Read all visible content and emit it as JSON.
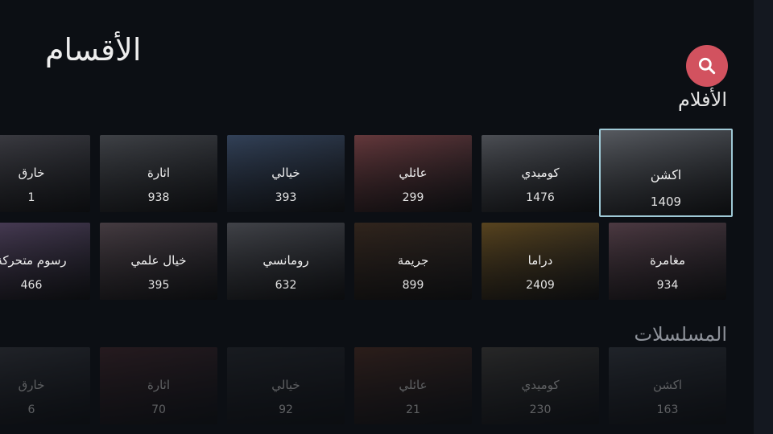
{
  "page_title": "الأقسام",
  "colors": {
    "accent": "#d2525f",
    "focus_border": "#9fc9d6",
    "background": "#0c0f14"
  },
  "search": {
    "icon": "search-icon"
  },
  "movies": {
    "title": "الأفلام",
    "rows": [
      [
        {
          "name": "اكشن",
          "count": "1409",
          "focused": true,
          "bg": "#6a6e75"
        },
        {
          "name": "كوميدي",
          "count": "1476",
          "bg": "#5c5f66"
        },
        {
          "name": "عائلي",
          "count": "299",
          "bg": "#7a4448"
        },
        {
          "name": "خيالي",
          "count": "393",
          "bg": "#3d4f6b"
        },
        {
          "name": "اثارة",
          "count": "938",
          "bg": "#4c4f55"
        },
        {
          "name": "خارق",
          "count": "1",
          "bg": "#4a4a52"
        }
      ],
      [
        {
          "name": "مغامرة",
          "count": "934",
          "bg": "#5d4650"
        },
        {
          "name": "دراما",
          "count": "2409",
          "bg": "#6b5225"
        },
        {
          "name": "جريمة",
          "count": "899",
          "bg": "#3b2c22"
        },
        {
          "name": "رومانسي",
          "count": "632",
          "bg": "#4f5158"
        },
        {
          "name": "خيال علمي",
          "count": "395",
          "bg": "#54484f"
        },
        {
          "name": "رسوم متحركة",
          "count": "466",
          "bg": "#5a4a6a"
        }
      ]
    ]
  },
  "series": {
    "title": "المسلسلات",
    "rows": [
      [
        {
          "name": "اكشن",
          "count": "163",
          "bg": "#4a4f58"
        },
        {
          "name": "كوميدي",
          "count": "230",
          "bg": "#5f5a52"
        },
        {
          "name": "عائلي",
          "count": "21",
          "bg": "#6b3d2c"
        },
        {
          "name": "خيالي",
          "count": "92",
          "bg": "#34373d"
        },
        {
          "name": "اثارة",
          "count": "70",
          "bg": "#5a3438"
        },
        {
          "name": "خارق",
          "count": "6",
          "bg": "#4e5058"
        }
      ]
    ]
  }
}
